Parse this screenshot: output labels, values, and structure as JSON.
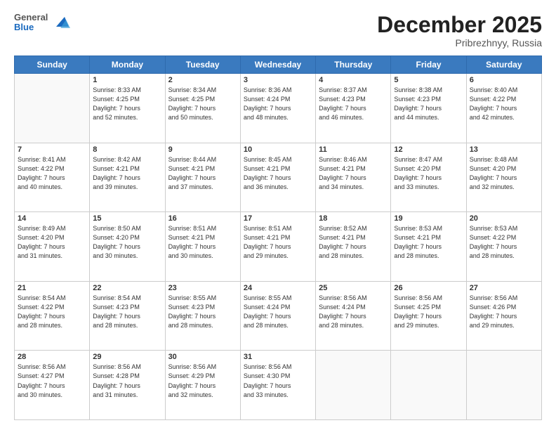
{
  "logo": {
    "general": "General",
    "blue": "Blue"
  },
  "header": {
    "month": "December 2025",
    "location": "Pribrezhnyy, Russia"
  },
  "weekdays": [
    "Sunday",
    "Monday",
    "Tuesday",
    "Wednesday",
    "Thursday",
    "Friday",
    "Saturday"
  ],
  "weeks": [
    [
      {
        "day": "",
        "text": ""
      },
      {
        "day": "1",
        "text": "Sunrise: 8:33 AM\nSunset: 4:25 PM\nDaylight: 7 hours\nand 52 minutes."
      },
      {
        "day": "2",
        "text": "Sunrise: 8:34 AM\nSunset: 4:25 PM\nDaylight: 7 hours\nand 50 minutes."
      },
      {
        "day": "3",
        "text": "Sunrise: 8:36 AM\nSunset: 4:24 PM\nDaylight: 7 hours\nand 48 minutes."
      },
      {
        "day": "4",
        "text": "Sunrise: 8:37 AM\nSunset: 4:23 PM\nDaylight: 7 hours\nand 46 minutes."
      },
      {
        "day": "5",
        "text": "Sunrise: 8:38 AM\nSunset: 4:23 PM\nDaylight: 7 hours\nand 44 minutes."
      },
      {
        "day": "6",
        "text": "Sunrise: 8:40 AM\nSunset: 4:22 PM\nDaylight: 7 hours\nand 42 minutes."
      }
    ],
    [
      {
        "day": "7",
        "text": "Sunrise: 8:41 AM\nSunset: 4:22 PM\nDaylight: 7 hours\nand 40 minutes."
      },
      {
        "day": "8",
        "text": "Sunrise: 8:42 AM\nSunset: 4:21 PM\nDaylight: 7 hours\nand 39 minutes."
      },
      {
        "day": "9",
        "text": "Sunrise: 8:44 AM\nSunset: 4:21 PM\nDaylight: 7 hours\nand 37 minutes."
      },
      {
        "day": "10",
        "text": "Sunrise: 8:45 AM\nSunset: 4:21 PM\nDaylight: 7 hours\nand 36 minutes."
      },
      {
        "day": "11",
        "text": "Sunrise: 8:46 AM\nSunset: 4:21 PM\nDaylight: 7 hours\nand 34 minutes."
      },
      {
        "day": "12",
        "text": "Sunrise: 8:47 AM\nSunset: 4:20 PM\nDaylight: 7 hours\nand 33 minutes."
      },
      {
        "day": "13",
        "text": "Sunrise: 8:48 AM\nSunset: 4:20 PM\nDaylight: 7 hours\nand 32 minutes."
      }
    ],
    [
      {
        "day": "14",
        "text": "Sunrise: 8:49 AM\nSunset: 4:20 PM\nDaylight: 7 hours\nand 31 minutes."
      },
      {
        "day": "15",
        "text": "Sunrise: 8:50 AM\nSunset: 4:20 PM\nDaylight: 7 hours\nand 30 minutes."
      },
      {
        "day": "16",
        "text": "Sunrise: 8:51 AM\nSunset: 4:21 PM\nDaylight: 7 hours\nand 30 minutes."
      },
      {
        "day": "17",
        "text": "Sunrise: 8:51 AM\nSunset: 4:21 PM\nDaylight: 7 hours\nand 29 minutes."
      },
      {
        "day": "18",
        "text": "Sunrise: 8:52 AM\nSunset: 4:21 PM\nDaylight: 7 hours\nand 28 minutes."
      },
      {
        "day": "19",
        "text": "Sunrise: 8:53 AM\nSunset: 4:21 PM\nDaylight: 7 hours\nand 28 minutes."
      },
      {
        "day": "20",
        "text": "Sunrise: 8:53 AM\nSunset: 4:22 PM\nDaylight: 7 hours\nand 28 minutes."
      }
    ],
    [
      {
        "day": "21",
        "text": "Sunrise: 8:54 AM\nSunset: 4:22 PM\nDaylight: 7 hours\nand 28 minutes."
      },
      {
        "day": "22",
        "text": "Sunrise: 8:54 AM\nSunset: 4:23 PM\nDaylight: 7 hours\nand 28 minutes."
      },
      {
        "day": "23",
        "text": "Sunrise: 8:55 AM\nSunset: 4:23 PM\nDaylight: 7 hours\nand 28 minutes."
      },
      {
        "day": "24",
        "text": "Sunrise: 8:55 AM\nSunset: 4:24 PM\nDaylight: 7 hours\nand 28 minutes."
      },
      {
        "day": "25",
        "text": "Sunrise: 8:56 AM\nSunset: 4:24 PM\nDaylight: 7 hours\nand 28 minutes."
      },
      {
        "day": "26",
        "text": "Sunrise: 8:56 AM\nSunset: 4:25 PM\nDaylight: 7 hours\nand 29 minutes."
      },
      {
        "day": "27",
        "text": "Sunrise: 8:56 AM\nSunset: 4:26 PM\nDaylight: 7 hours\nand 29 minutes."
      }
    ],
    [
      {
        "day": "28",
        "text": "Sunrise: 8:56 AM\nSunset: 4:27 PM\nDaylight: 7 hours\nand 30 minutes."
      },
      {
        "day": "29",
        "text": "Sunrise: 8:56 AM\nSunset: 4:28 PM\nDaylight: 7 hours\nand 31 minutes."
      },
      {
        "day": "30",
        "text": "Sunrise: 8:56 AM\nSunset: 4:29 PM\nDaylight: 7 hours\nand 32 minutes."
      },
      {
        "day": "31",
        "text": "Sunrise: 8:56 AM\nSunset: 4:30 PM\nDaylight: 7 hours\nand 33 minutes."
      },
      {
        "day": "",
        "text": ""
      },
      {
        "day": "",
        "text": ""
      },
      {
        "day": "",
        "text": ""
      }
    ]
  ]
}
